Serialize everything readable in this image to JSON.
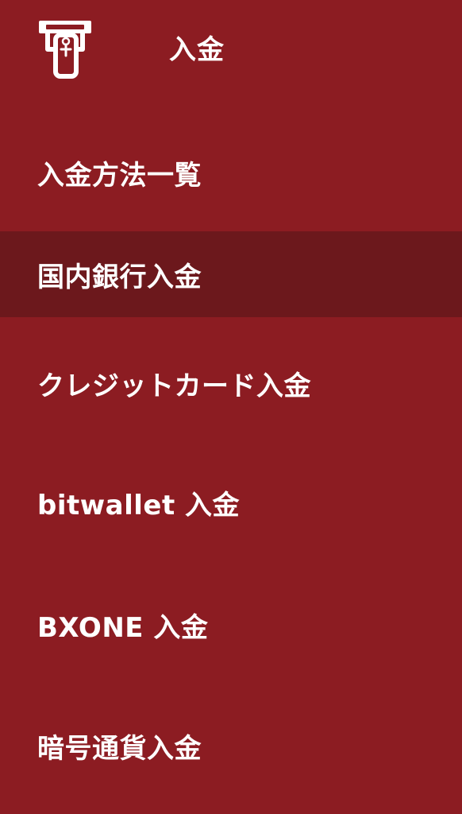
{
  "header": {
    "title": "入金",
    "icon": "atm-deposit-icon"
  },
  "menu": {
    "items": [
      {
        "label": "入金方法一覧",
        "active": false
      },
      {
        "label": "国内銀行入金",
        "active": true
      },
      {
        "label": "クレジットカード入金",
        "active": false
      },
      {
        "label": "bitwallet 入金",
        "active": false
      },
      {
        "label": "BXONE 入金",
        "active": false
      },
      {
        "label": "暗号通貨入金",
        "active": false
      }
    ]
  },
  "colors": {
    "background": "#8c1c22",
    "active_background": "#6c181c",
    "text": "#ffffff"
  }
}
